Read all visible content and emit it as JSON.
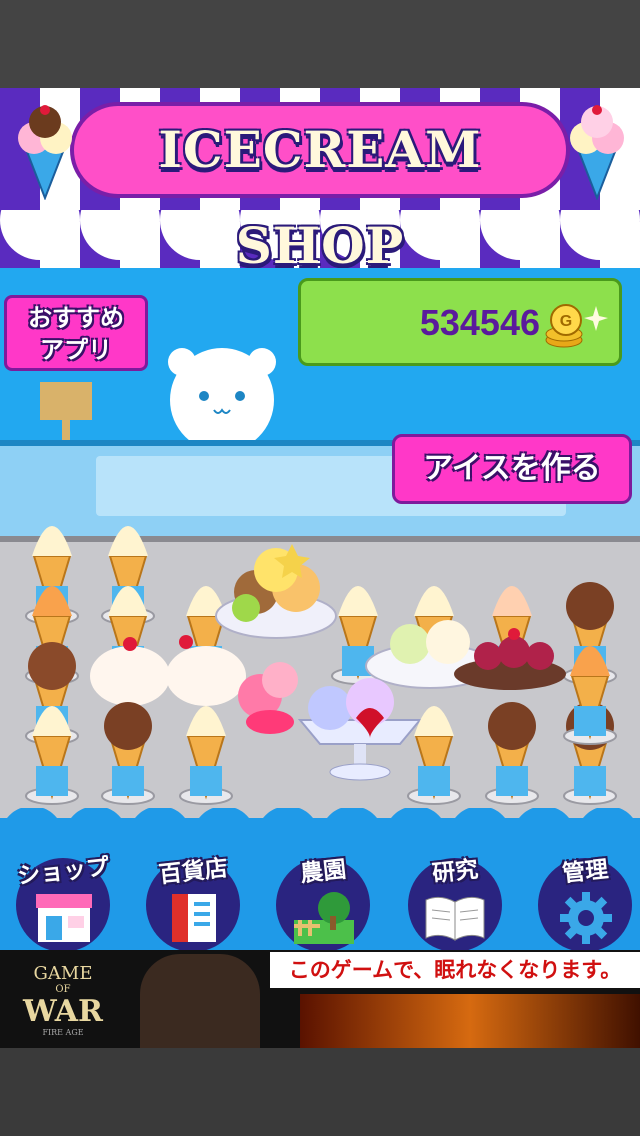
{
  "shop": {
    "title": "ICECREAM SHOP"
  },
  "header": {
    "recommend_line1": "おすすめ",
    "recommend_line2": "アプリ",
    "coins": "534546",
    "coin_icon": "gold-coin-icon"
  },
  "actions": {
    "make_ice_label": "アイスを作る"
  },
  "nav": {
    "items": [
      {
        "label": "ショップ",
        "icon": "storefront-icon"
      },
      {
        "label": "百貨店",
        "icon": "department-store-icon"
      },
      {
        "label": "農園",
        "icon": "farm-icon"
      },
      {
        "label": "研究",
        "icon": "book-icon"
      },
      {
        "label": "管理",
        "icon": "gear-icon"
      }
    ]
  },
  "ad": {
    "logo_line1": "GAME",
    "logo_line2": "OF",
    "logo_line3": "WAR",
    "logo_line4": "FIRE AGE",
    "tagline": "このゲームで、眠れなくなります。"
  },
  "colors": {
    "awning_purple": "#5a2bbf",
    "wall_blue": "#22a8f0",
    "button_pink": "#ff38c8",
    "coin_panel_green": "#8de04c",
    "coin_text_purple": "#5a1a9c"
  }
}
